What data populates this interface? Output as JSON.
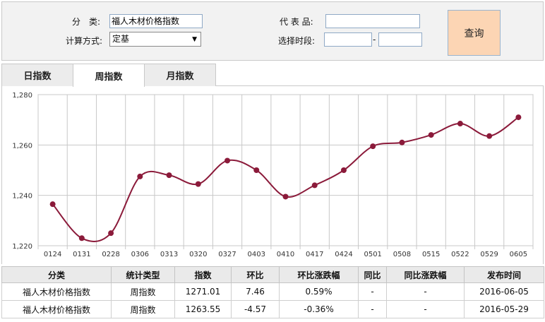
{
  "form": {
    "category_label": "分　类:",
    "category_value": "福人木材价格指数",
    "calc_label": "计算方式:",
    "calc_value": "定基",
    "product_label": "代 表 品:",
    "product_value": "",
    "period_label": "选择时段:",
    "date_from": "",
    "date_to": "",
    "date_sep": "-",
    "query_label": "查询"
  },
  "tabs": [
    {
      "label": "日指数",
      "active": false
    },
    {
      "label": "周指数",
      "active": true
    },
    {
      "label": "月指数",
      "active": false
    }
  ],
  "chart_data": {
    "type": "line",
    "categories": [
      "0124",
      "0131",
      "0228",
      "0306",
      "0313",
      "0320",
      "0327",
      "0403",
      "0410",
      "0417",
      "0424",
      "0501",
      "0508",
      "0515",
      "0522",
      "0529",
      "0605"
    ],
    "values": [
      1236.5,
      1223.0,
      1225.0,
      1247.5,
      1248.0,
      1244.5,
      1253.8,
      1250.0,
      1239.5,
      1244.0,
      1250.0,
      1259.5,
      1261.0,
      1264.0,
      1268.5,
      1263.55,
      1271.01
    ],
    "ylim": [
      1220,
      1280
    ],
    "yticks": [
      1220,
      1240,
      1260,
      1280
    ],
    "ytick_labels": [
      "1,220",
      "1,240",
      "1,260",
      "1,280"
    ],
    "grid": true,
    "line_color": "#8b1a3a",
    "title": "",
    "xlabel": "",
    "ylabel": ""
  },
  "table": {
    "headers": [
      "分类",
      "统计类型",
      "指数",
      "环比",
      "环比涨跌幅",
      "同比",
      "同比涨跌幅",
      "发布时间"
    ],
    "rows": [
      {
        "category": "福人木材价格指数",
        "type": "周指数",
        "index": "1271.01",
        "mom": "7.46",
        "mom_pct": "0.59%",
        "yoy": "-",
        "yoy_pct": "-",
        "date": "2016-06-05",
        "dir": "up"
      },
      {
        "category": "福人木材价格指数",
        "type": "周指数",
        "index": "1263.55",
        "mom": "-4.57",
        "mom_pct": "-0.36%",
        "yoy": "-",
        "yoy_pct": "-",
        "date": "2016-05-29",
        "dir": "down"
      }
    ]
  }
}
